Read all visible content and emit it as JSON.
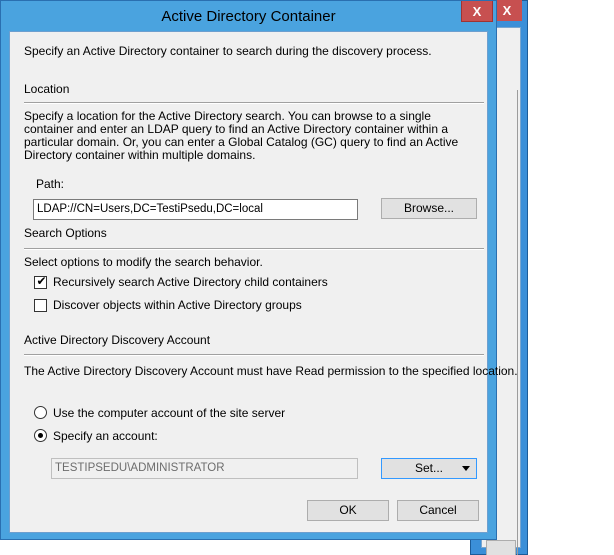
{
  "window": {
    "title": "Active Directory Container",
    "close_glyph": "X"
  },
  "background_window": {
    "close_glyph": "X"
  },
  "intro_text": "Specify an Active Directory container to search during the discovery process.",
  "location": {
    "heading": "Location",
    "description": "Specify a location for the Active Directory search. You can browse to a single container and enter an LDAP query to find an Active Directory container within a particular domain. Or, you can enter a Global Catalog (GC) query to find an Active Directory container within multiple domains.",
    "path_label": "Path:",
    "path_value": "LDAP://CN=Users,DC=TestiPsedu,DC=local",
    "browse_label": "Browse..."
  },
  "search_options": {
    "heading": "Search Options",
    "description": "Select options to modify the search behavior.",
    "options": [
      {
        "label": "Recursively search Active Directory child containers",
        "checked": true,
        "check_glyph": "✔"
      },
      {
        "label": "Discover objects within Active Directory groups",
        "checked": false
      }
    ]
  },
  "discovery_account": {
    "heading": "Active Directory Discovery Account",
    "description": "The Active Directory Discovery Account must have Read permission to the specified location.",
    "radio_options": [
      {
        "label": "Use the computer account of the site server",
        "selected": false
      },
      {
        "label": "Specify an account:",
        "selected": true
      }
    ],
    "account_value": "TESTIPSEDU\\ADMINISTRATOR",
    "set_label": "Set..."
  },
  "footer": {
    "ok_label": "OK",
    "cancel_label": "Cancel"
  },
  "colors": {
    "title_bar": "#4aa3df",
    "close_button": "#c75050",
    "dialog_background": "#f0f0f0",
    "focus_border": "#3399ff"
  }
}
